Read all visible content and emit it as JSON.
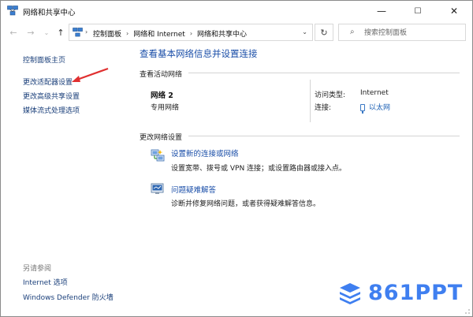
{
  "window": {
    "title": "网络和共享中心",
    "controls": {
      "minimize": "—",
      "maximize": "☐",
      "close": "✕"
    }
  },
  "address": {
    "back": "←",
    "forward": "→",
    "up": "↑",
    "crumbs": [
      "控制面板",
      "网络和 Internet",
      "网络和共享中心"
    ],
    "crumb_sep": "›",
    "dropdown": "⌄",
    "refresh": "↻",
    "search_placeholder": "搜索控制面板"
  },
  "left_pane": {
    "home": "控制面板主页",
    "links": [
      "更改适配器设置",
      "更改高级共享设置",
      "媒体流式处理选项"
    ],
    "see_also_title": "另请参阅",
    "see_also": [
      "Internet 选项",
      "Windows Defender 防火墙"
    ]
  },
  "main": {
    "title": "查看基本网络信息并设置连接",
    "active_networks_label": "查看活动网络",
    "network": {
      "name": "网络 2",
      "type": "专用网络",
      "access_type_label": "访问类型:",
      "access_type_value": "Internet",
      "connections_label": "连接:",
      "connections_value": "以太网"
    },
    "change_settings_label": "更改网络设置",
    "tasks": [
      {
        "link": "设置新的连接或网络",
        "desc": "设置宽带、拨号或 VPN 连接；或设置路由器或接入点。",
        "icon": "network-setup-icon"
      },
      {
        "link": "问题疑难解答",
        "desc": "诊断并修复网络问题，或者获得疑难解答信息。",
        "icon": "troubleshoot-icon"
      }
    ]
  },
  "watermark": {
    "text": "861PPT"
  },
  "colors": {
    "link": "#1a4ea8",
    "arrow": "#e03030",
    "watermark": "#3f7ff0"
  }
}
